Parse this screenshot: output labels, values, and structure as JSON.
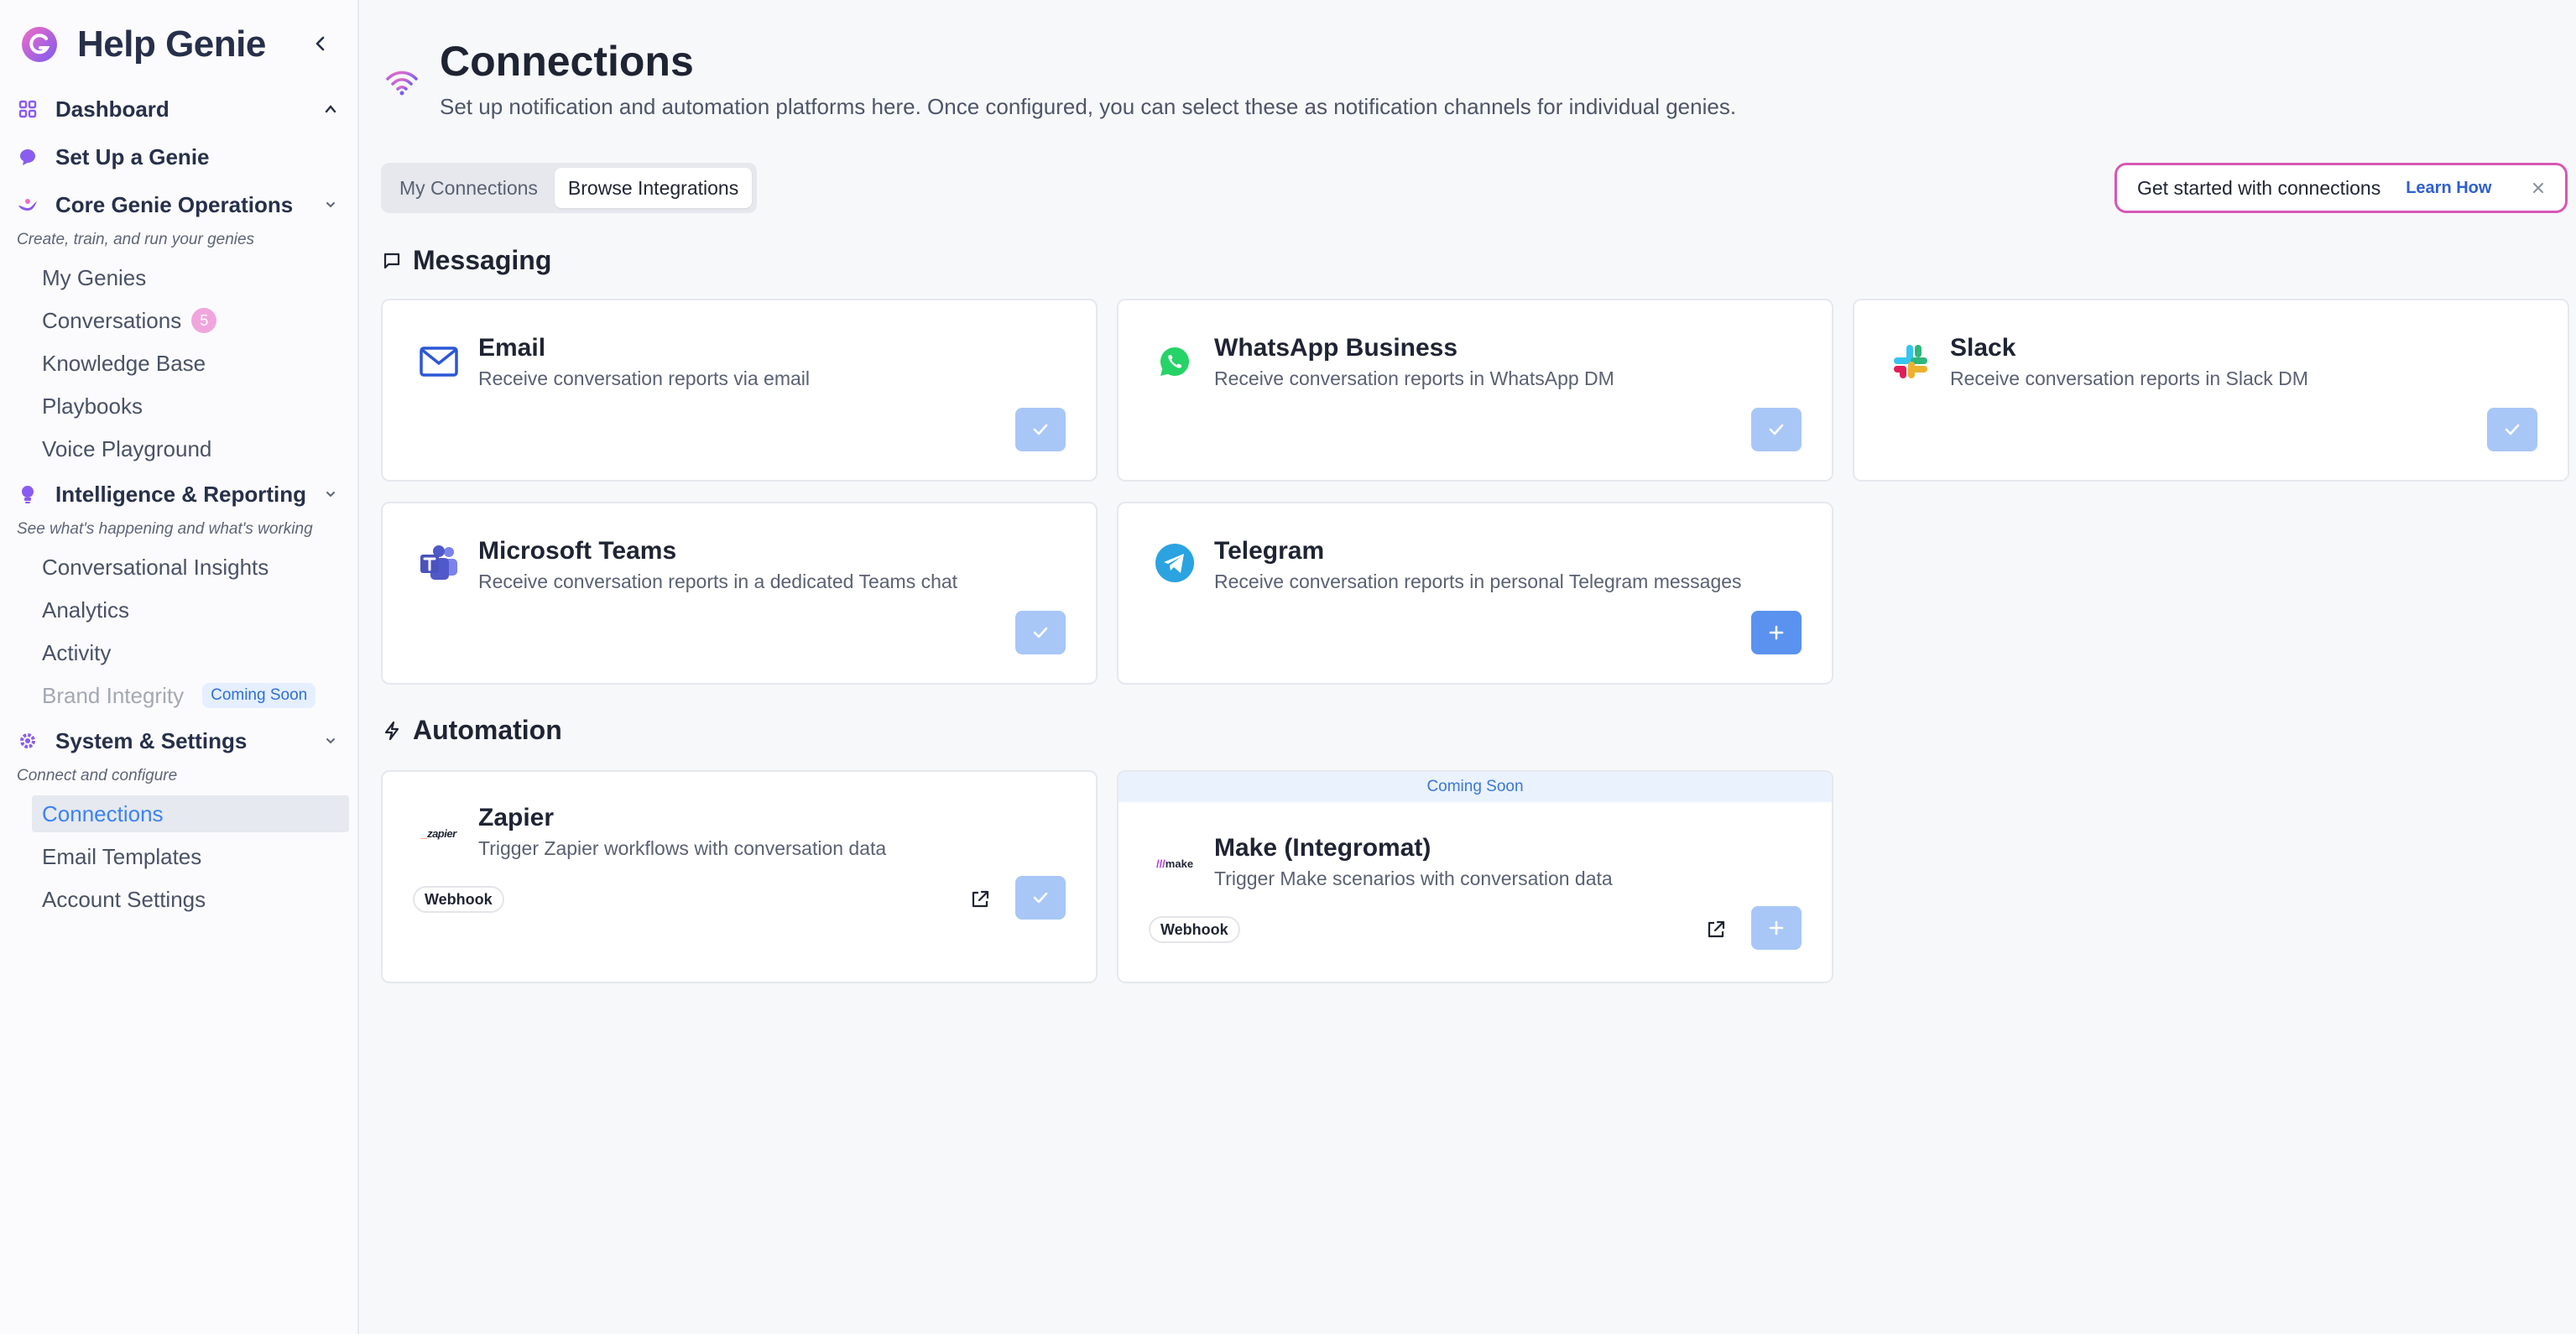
{
  "app": {
    "name": "Help Genie"
  },
  "sidebar": {
    "dashboard": {
      "label": "Dashboard"
    },
    "setup": {
      "label": "Set Up a Genie"
    },
    "core": {
      "label": "Core Genie Operations",
      "desc": "Create, train, and run your genies",
      "items": [
        {
          "label": "My Genies"
        },
        {
          "label": "Conversations",
          "badge": "5"
        },
        {
          "label": "Knowledge Base"
        },
        {
          "label": "Playbooks"
        },
        {
          "label": "Voice Playground"
        }
      ]
    },
    "intel": {
      "label": "Intelligence & Reporting",
      "desc": "See what's happening and what's working",
      "items": [
        {
          "label": "Conversational Insights"
        },
        {
          "label": "Analytics"
        },
        {
          "label": "Activity"
        },
        {
          "label": "Brand Integrity",
          "badge": "Coming Soon"
        }
      ]
    },
    "system": {
      "label": "System & Settings",
      "desc": "Connect and configure",
      "items": [
        {
          "label": "Connections",
          "active": true
        },
        {
          "label": "Email Templates"
        },
        {
          "label": "Account Settings"
        }
      ]
    }
  },
  "header": {
    "title": "Connections",
    "subtitle": "Set up notification and automation platforms here. Once configured, you can select these as notification channels for individual genies."
  },
  "tabs": [
    {
      "label": "My Connections",
      "active": false
    },
    {
      "label": "Browse Integrations",
      "active": true
    }
  ],
  "promo": {
    "text": "Get started with connections",
    "link": "Learn How"
  },
  "messaging": {
    "title": "Messaging",
    "cards": [
      {
        "title": "Email",
        "desc": "Receive conversation reports via email",
        "status": "connected",
        "icon": "mail-icon"
      },
      {
        "title": "WhatsApp Business",
        "desc": "Receive conversation reports in WhatsApp DM",
        "status": "connected",
        "icon": "whatsapp-icon"
      },
      {
        "title": "Slack",
        "desc": "Receive conversation reports in Slack DM",
        "status": "connected",
        "icon": "slack-icon"
      },
      {
        "title": "Microsoft Teams",
        "desc": "Receive conversation reports in a dedicated Teams chat",
        "status": "connected",
        "icon": "teams-icon"
      },
      {
        "title": "Telegram",
        "desc": "Receive conversation reports in personal Telegram messages",
        "status": "add",
        "icon": "telegram-icon"
      }
    ]
  },
  "automation": {
    "title": "Automation",
    "cards": [
      {
        "title": "Zapier",
        "desc": "Trigger Zapier workflows with conversation data",
        "tag": "Webhook",
        "logo_text": "zapier",
        "status": "connected"
      },
      {
        "title": "Make (Integromat)",
        "desc": "Trigger Make scenarios with conversation data",
        "tag": "Webhook",
        "logo_text": "make",
        "banner": "Coming Soon",
        "status": "disabled"
      }
    ]
  },
  "colors": {
    "accent": "#3b82f6",
    "brand": "#d857b4",
    "button_done": "#a8c7f7",
    "button_add": "#5b92ef"
  }
}
